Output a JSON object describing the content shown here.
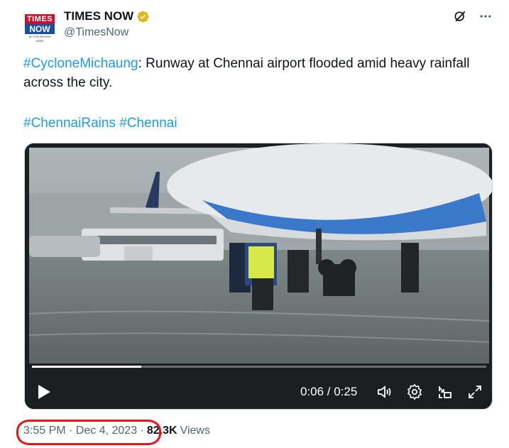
{
  "author": {
    "display_name": "TIMES NOW",
    "handle": "@TimesNow",
    "logo_line1": "TIMES",
    "logo_line2": "NOW",
    "logo_tagline": "ACTION BEGINS HERE",
    "verified_color": "#e2b719"
  },
  "tweet": {
    "hashtag_lead": "#CycloneMichaung",
    "text_main": ": Runway at Chennai airport flooded amid heavy rainfall across the city.",
    "hashtag_1": "#ChennaiRains",
    "hashtag_2": "#Chennai"
  },
  "video": {
    "time_display": "0:06 / 0:25",
    "progress_fraction": 0.24
  },
  "footer": {
    "timestamp": "3:55 PM · Dec 4, 2023 ·",
    "views_count": "82.3K",
    "views_label": "Views"
  },
  "icons": {
    "grok": "grok-icon",
    "more": "more-icon",
    "play": "play-icon",
    "volume": "volume-icon",
    "settings": "settings-icon",
    "pip": "pip-icon",
    "fullscreen": "fullscreen-icon"
  },
  "colors": {
    "link": "#1d9bf0",
    "secondary_text": "#536471",
    "annotation": "#e8141a"
  }
}
